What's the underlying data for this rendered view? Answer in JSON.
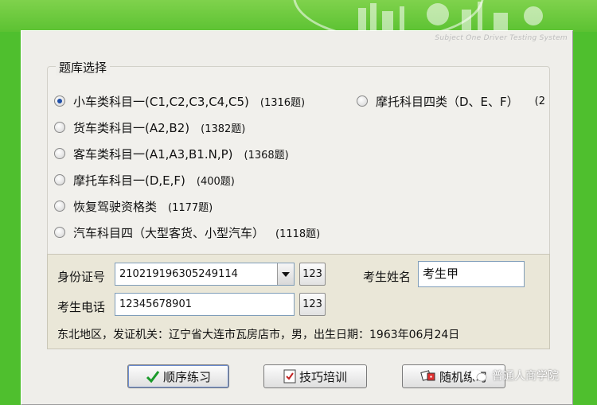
{
  "app": {
    "subtitle": "Subject One Driver Testing System"
  },
  "group": {
    "title": "题库选择",
    "options": [
      {
        "name": "小车类科目一(C1,C2,C3,C4,C5)",
        "count": "(1316题)",
        "selected": true
      },
      {
        "name": "货车类科目一(A2,B2)",
        "count": "(1382题)",
        "selected": false
      },
      {
        "name": "客车类科目一(A1,A3,B1.N,P)",
        "count": "(1368题)",
        "selected": false
      },
      {
        "name": "摩托车科目一(D,E,F)",
        "count": "(400题)",
        "selected": false
      },
      {
        "name": "恢复驾驶资格类",
        "count": "(1177题)",
        "selected": false
      },
      {
        "name": "汽车科目四（大型客货、小型汽车）",
        "count": "(1118题)",
        "selected": false
      },
      {
        "name": "摩托科目四类（D、E、F）",
        "count": "(2",
        "selected": false
      }
    ]
  },
  "info": {
    "id_label": "身份证号",
    "id_value": "210219196305249114",
    "id_btn": "123",
    "name_label": "考生姓名",
    "name_value": "考生甲",
    "phone_label": "考生电话",
    "phone_value": "12345678901",
    "phone_btn": "123",
    "address": "东北地区，发证机关：辽宁省大连市瓦房店市，男，出生日期：1963年06月24日"
  },
  "buttons": {
    "sequence": "顺序练习",
    "skills": "技巧培训",
    "random": "随机练习"
  },
  "watermark": "普通人商学院",
  "colors": {
    "background": "#4fbf2e",
    "dialog": "#efeeea",
    "info_panel": "#eae7d8"
  }
}
